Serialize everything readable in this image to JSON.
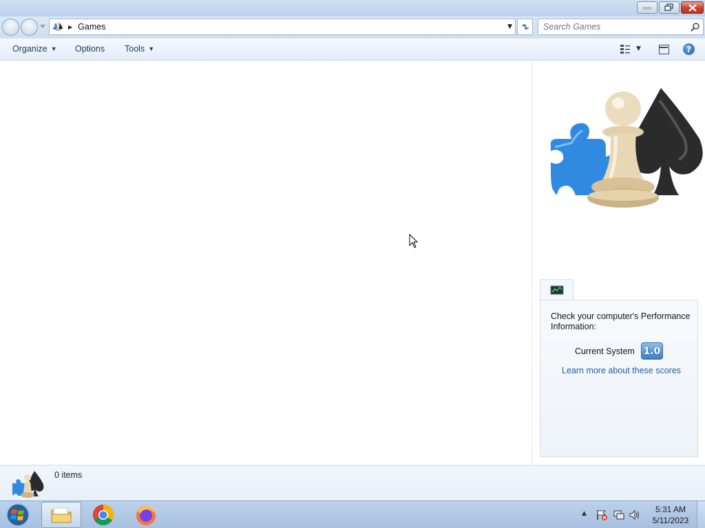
{
  "window": {
    "controls": [
      "minimize",
      "restore",
      "close"
    ]
  },
  "address_bar": {
    "breadcrumb_icon": "games-folder-icon",
    "breadcrumb": "Games"
  },
  "search": {
    "placeholder": "Search Games"
  },
  "command_bar": {
    "organize": "Organize",
    "options": "Options",
    "tools": "Tools"
  },
  "performance": {
    "tab_icon": "performance-monitor-icon",
    "message": "Check your computer's Performance Information:",
    "score_label": "Current System",
    "score": "1.0",
    "link": "Learn more about these scores"
  },
  "details": {
    "count": "0 items"
  },
  "taskbar": {
    "items": [
      "windows-explorer",
      "google-chrome",
      "firefox"
    ],
    "time": "5:31 AM",
    "date": "5/11/2023"
  },
  "colors": {
    "link": "#1f5fa8",
    "command_text": "#1e395b",
    "close_button": "#c9432d"
  }
}
